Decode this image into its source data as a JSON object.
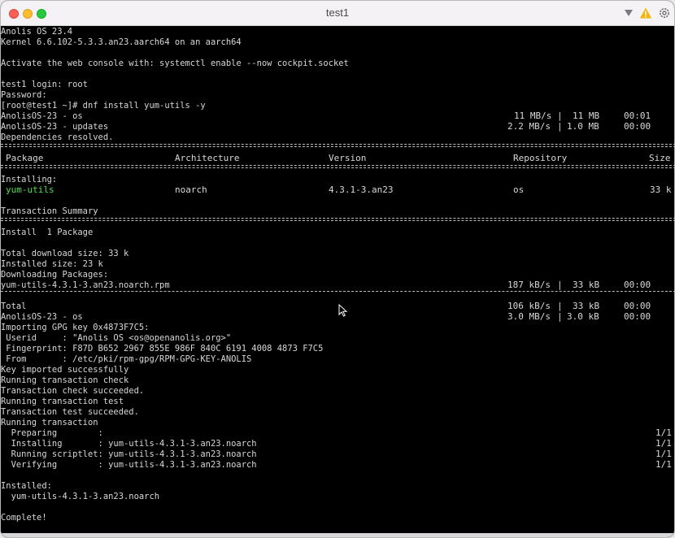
{
  "window": {
    "title": "test1",
    "icons": [
      "chevron-down-icon",
      "warning-icon",
      "gear-icon"
    ],
    "colors": {
      "close": "#fe5f57",
      "minimize": "#febc2e",
      "maximize": "#28c840",
      "warning": "#f5b50a",
      "green_text": "#4fe04f"
    }
  },
  "terminal": {
    "lines": [
      "Anolis OS 23.4",
      "Kernel 6.6.102-5.3.3.an23.aarch64 on an aarch64",
      "",
      "Activate the web console with: systemctl enable --now cockpit.socket",
      "",
      "test1 login: root",
      "Password:",
      "[root@test1 ~]# dnf install yum-utils -y",
      "AnolisOS-23 - os",
      "AnolisOS-23 - updates",
      "Dependencies resolved."
    ],
    "repo_progress": [
      {
        "speed": "11 MB/s",
        "size": "11 MB",
        "time": "00:01"
      },
      {
        "speed": "2.2 MB/s",
        "size": "1.0 MB",
        "time": "00:00"
      }
    ],
    "table": {
      "headers": [
        "Package",
        "Architecture",
        "Version",
        "Repository",
        "Size"
      ],
      "installing_label": "Installing:",
      "row": [
        "yum-utils",
        "noarch",
        "4.3.1-3.an23",
        "os",
        "33 k"
      ]
    },
    "summary": {
      "title": "Transaction Summary",
      "install": "Install  1 Package",
      "total_download": "Total download size: 33 k",
      "installed_size": "Installed size: 23 k",
      "downloading": "Downloading Packages:",
      "rpm_line": "yum-utils-4.3.1-3.an23.noarch.rpm",
      "rpm_speed": "187 kB/s",
      "rpm_size": "33 kB",
      "rpm_time": "00:00",
      "total_label": "Total",
      "total_speed": "106 kB/s",
      "total_size": "33 kB",
      "total_time": "00:00",
      "repo2_label": "AnolisOS-23 - os",
      "repo2_speed": "3.0 MB/s",
      "repo2_size": "3.0 kB",
      "repo2_time": "00:00"
    },
    "gpg": [
      "Importing GPG key 0x4873F7C5:",
      " Userid     : \"Anolis OS <os@openanolis.org>\"",
      " Fingerprint: F87D B652 2967 855E 986F 840C 6191 4008 4873 F7C5",
      " From       : /etc/pki/rpm-gpg/RPM-GPG-KEY-ANOLIS",
      "Key imported successfully",
      "Running transaction check",
      "Transaction check succeeded.",
      "Running transaction test",
      "Transaction test succeeded.",
      "Running transaction"
    ],
    "steps": [
      {
        "text": "  Preparing        :",
        "count": "1/1"
      },
      {
        "text": "  Installing       : yum-utils-4.3.1-3.an23.noarch",
        "count": "1/1"
      },
      {
        "text": "  Running scriptlet: yum-utils-4.3.1-3.an23.noarch",
        "count": "1/1"
      },
      {
        "text": "  Verifying        : yum-utils-4.3.1-3.an23.noarch",
        "count": "1/1"
      }
    ],
    "installed_label": "Installed:",
    "installed_pkg": "  yum-utils-4.3.1-3.an23.noarch",
    "complete": "Complete!"
  }
}
